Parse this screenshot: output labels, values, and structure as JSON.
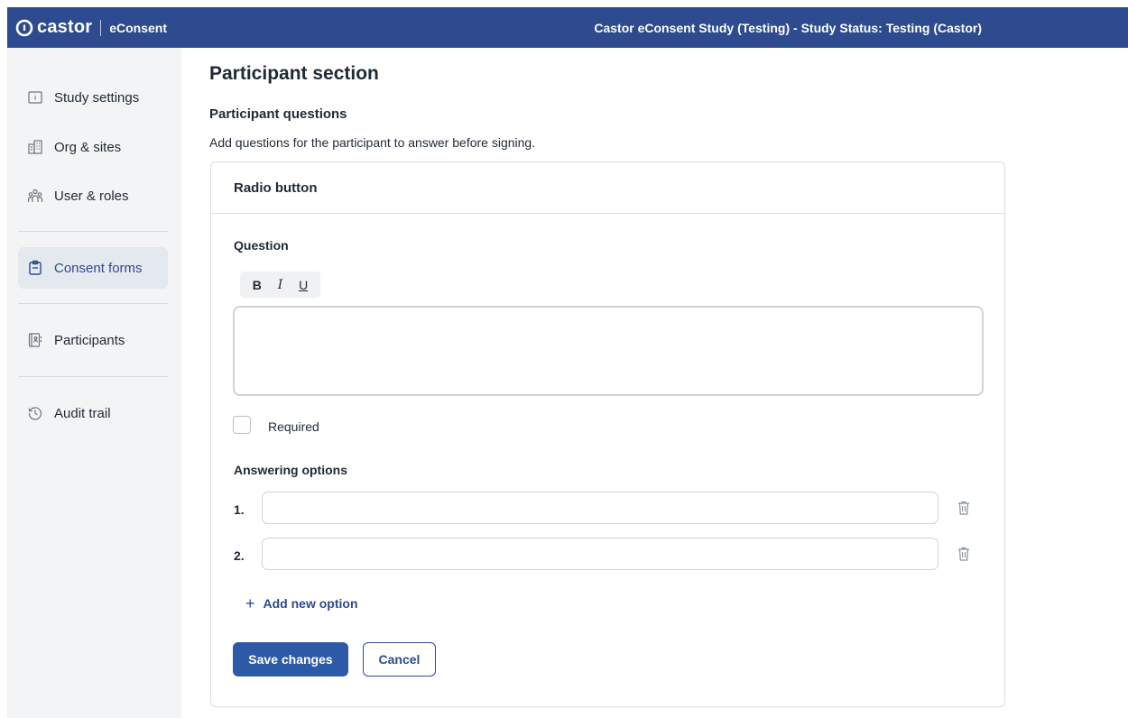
{
  "topbar": {
    "brand_name": "castor",
    "brand_sub": "eConsent",
    "study_status": "Castor eConsent Study (Testing)  - Study Status: Testing (Castor)",
    "brand_color": "#2d4b8e"
  },
  "sidebar": {
    "items": [
      {
        "label": "Study settings",
        "icon": "info-folder-icon"
      },
      {
        "label": "Org & sites",
        "icon": "building-icon"
      },
      {
        "label": "User & roles",
        "icon": "users-icon"
      },
      {
        "label": "Consent forms",
        "icon": "clipboard-icon",
        "active": true
      },
      {
        "label": "Participants",
        "icon": "contact-book-icon"
      },
      {
        "label": "Audit trail",
        "icon": "history-icon"
      }
    ]
  },
  "main": {
    "page_title": "Participant section",
    "section_title": "Participant questions",
    "section_desc": "Add questions for the participant to answer before signing."
  },
  "card": {
    "header": "Radio button",
    "question_label": "Question",
    "toolbar": {
      "bold": "B",
      "italic": "I",
      "underline": "U"
    },
    "question_value": "",
    "required_label": "Required",
    "required_checked": false,
    "answering_label": "Answering options",
    "options": [
      {
        "number": "1.",
        "value": ""
      },
      {
        "number": "2.",
        "value": ""
      }
    ],
    "add_option_icon": "+",
    "add_option_label": "Add new option",
    "save_label": "Save changes",
    "cancel_label": "Cancel"
  }
}
